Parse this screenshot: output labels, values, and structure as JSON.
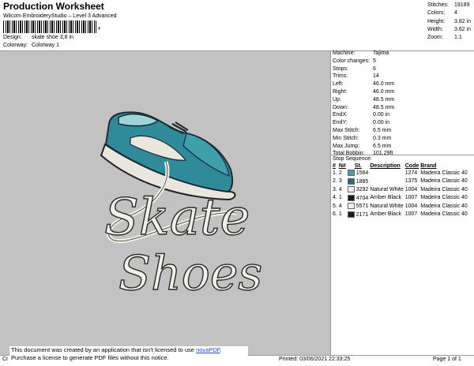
{
  "header": {
    "title": "Production Worksheet",
    "subtitle": "Wilcom EmbroideryStudio – Level 3 Advanced",
    "barcode_tail": ",",
    "design_label": "Design:",
    "design_value": "skate shoe 3,8 in",
    "colorway_label": "Colorway:",
    "colorway_value": "Colorway 1"
  },
  "stats": [
    {
      "label": "Stitches:",
      "value": "19189"
    },
    {
      "label": "Colors:",
      "value": "4"
    },
    {
      "label": "Height:",
      "value": "3.82 in"
    },
    {
      "label": "Width:",
      "value": "3.62 in"
    },
    {
      "label": "Zoom:",
      "value": "1:1"
    }
  ],
  "machine_info": [
    {
      "label": "Machine:",
      "value": "Tajima"
    },
    {
      "label": "Color changes:",
      "value": "5"
    },
    {
      "label": "Stops:",
      "value": "6"
    },
    {
      "label": "Trims:",
      "value": "14"
    },
    {
      "label": "Left:",
      "value": "46.0 mm"
    },
    {
      "label": "Right:",
      "value": "46.0 mm"
    },
    {
      "label": "Up:",
      "value": "48.5 mm"
    },
    {
      "label": "Down:",
      "value": "48.5 mm"
    },
    {
      "label": "EndX:",
      "value": "0.00 in"
    },
    {
      "label": "EndY:",
      "value": "0.00 in"
    },
    {
      "label": "Max Stitch:",
      "value": "6.5 mm"
    },
    {
      "label": "Min Stitch:",
      "value": "0.3 mm"
    },
    {
      "label": "Max Jump:",
      "value": "6.5 mm"
    },
    {
      "label": "Total Bobbin:",
      "value": "101.29ft"
    }
  ],
  "stop_sequence": {
    "title": "Stop Sequence:",
    "columns": [
      "#",
      "N#",
      "St.",
      "Description",
      "Code",
      "Brand"
    ],
    "rows": [
      {
        "num": "1.",
        "n": "2",
        "color": "#4f9aa6",
        "st": "1564",
        "desc": "",
        "code": "1274",
        "brand": "Madeira Classic 40"
      },
      {
        "num": "2.",
        "n": "3",
        "color": "#1e6f86",
        "st": "1885",
        "desc": "",
        "code": "1375",
        "brand": "Madeira Classic 40"
      },
      {
        "num": "3.",
        "n": "4",
        "color": "#f2f0e8",
        "st": "3292",
        "desc": "Natural White",
        "code": "1004",
        "brand": "Madeira Classic 40"
      },
      {
        "num": "4.",
        "n": "1",
        "color": "#1b1b1b",
        "st": "4704",
        "desc": "Amber Black",
        "code": "1007",
        "brand": "Madeira Classic 40"
      },
      {
        "num": "5.",
        "n": "4",
        "color": "#f2f0e8",
        "st": "5571",
        "desc": "Natural White",
        "code": "1004",
        "brand": "Madeira Classic 40"
      },
      {
        "num": "6.",
        "n": "1",
        "color": "#1b1b1b",
        "st": "2171",
        "desc": "Amber Black",
        "code": "1007",
        "brand": "Madeira Classic 40"
      }
    ]
  },
  "design_text": {
    "line1": "Skate",
    "line2": "Shoes"
  },
  "footer": {
    "left": "Cr",
    "printed": "Printed: 03/06/2021 22:33:25",
    "page": "Page 1 of 1"
  },
  "notice": {
    "line1_prefix": "This document was created by an application that isn't licensed to use ",
    "link": "novaPDF",
    "line1_suffix": ".",
    "line2": "Purchase a license to generate PDF files without this notice."
  }
}
